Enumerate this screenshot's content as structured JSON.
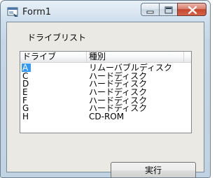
{
  "window": {
    "title": "Form1"
  },
  "form": {
    "heading": "ドライブリスト",
    "columns": [
      "ドライブ",
      "種別"
    ],
    "rows": [
      {
        "drive": "A",
        "type": "リムーバブルディスク",
        "selected": true
      },
      {
        "drive": "C",
        "type": "ハードディスク"
      },
      {
        "drive": "D",
        "type": "ハードディスク"
      },
      {
        "drive": "E",
        "type": "ハードディスク"
      },
      {
        "drive": "F",
        "type": "ハードディスク"
      },
      {
        "drive": "G",
        "type": "ハードディスク"
      },
      {
        "drive": "H",
        "type": "CD-ROM"
      }
    ],
    "run_label": "実行"
  },
  "colors": {
    "selection": "#3399ff",
    "close_button": "#c5452d"
  }
}
